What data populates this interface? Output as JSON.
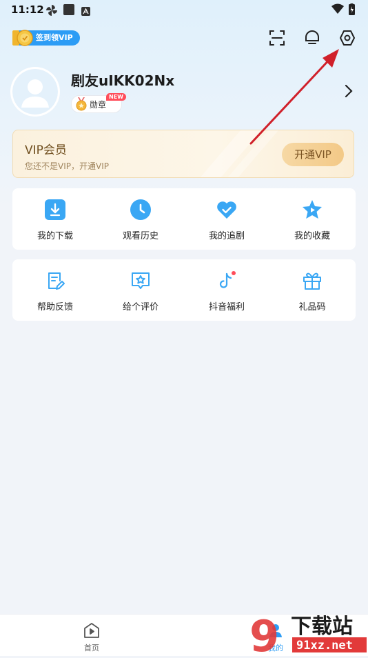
{
  "status_bar": {
    "time": "11:12"
  },
  "header": {
    "signin_label": "签到领VIP"
  },
  "profile": {
    "username": "剧友uIKK02Nx",
    "badge_label": "勋章",
    "badge_new": "NEW"
  },
  "vip_card": {
    "title": "VIP会员",
    "subtitle": "您还不是VIP，开通VIP",
    "button_label": "开通VIP"
  },
  "grid1": [
    {
      "label": "我的下载",
      "icon": "download-icon"
    },
    {
      "label": "观看历史",
      "icon": "clock-icon"
    },
    {
      "label": "我的追剧",
      "icon": "heart-check-icon"
    },
    {
      "label": "我的收藏",
      "icon": "star-icon"
    }
  ],
  "grid2": [
    {
      "label": "帮助反馈",
      "icon": "feedback-icon"
    },
    {
      "label": "给个评价",
      "icon": "rating-icon"
    },
    {
      "label": "抖音福利",
      "icon": "douyin-icon"
    },
    {
      "label": "礼品码",
      "icon": "gift-icon"
    }
  ],
  "bottom_nav": [
    {
      "label": "首页",
      "icon": "home-play-icon"
    },
    {
      "label": "我的",
      "icon": "profile-icon"
    }
  ],
  "watermark": {
    "number": "9",
    "text": "下载站",
    "url": "91xz.net"
  },
  "colors": {
    "accent": "#2c9cf5",
    "icon_blue": "#3aa7f4",
    "vip_gold": "#f3c987",
    "annotation_red": "#d0202a"
  }
}
